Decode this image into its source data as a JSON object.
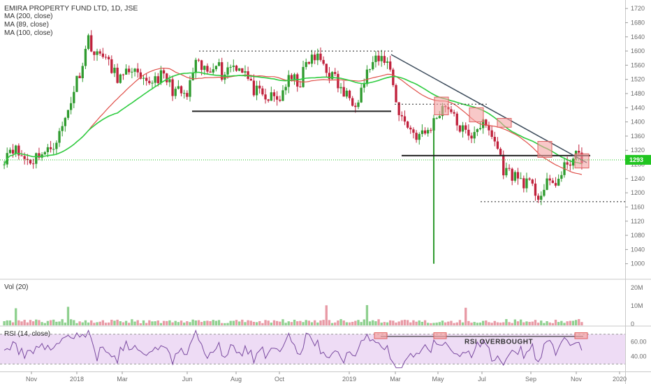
{
  "chart_title": "EMIRA PROPERTY FUND LTD, 1D, JSE",
  "indicators": [
    "MA (200, close)",
    "MA (89, close)",
    "MA (100, close)"
  ],
  "volume_label": "Vol (20)",
  "rsi_label": "RSI (14, close)",
  "annotation": "RSI OVERBOUGHT",
  "last_price": "1293",
  "colors": {
    "up": "#2f9b2f",
    "down": "#c0213c",
    "ma_green": "#2ecc40",
    "ma_red": "#e0504a",
    "rsi_line": "#7a4aa0",
    "rsi_band": "#eedcf5",
    "badge": "#21c521",
    "highlight_fill": "#f4a3a3",
    "highlight_stroke": "#e06060"
  },
  "chart_data": {
    "type": "candlestick",
    "title": "EMIRA PROPERTY FUND LTD, 1D, JSE",
    "x_ticks": [
      "Nov",
      "2018",
      "Mar",
      "Jun",
      "Aug",
      "Oct",
      "2019",
      "Mar",
      "May",
      "Jul",
      "Sep",
      "Nov",
      "2020"
    ],
    "price_ticks": [
      1000,
      1040,
      1080,
      1120,
      1160,
      1200,
      1240,
      1280,
      1320,
      1360,
      1400,
      1440,
      1480,
      1520,
      1560,
      1600,
      1640,
      1680,
      1720
    ],
    "price_range": [
      960,
      1740
    ],
    "volume_ticks": [
      "0",
      "10M",
      "20M"
    ],
    "rsi_ticks": [
      "40.00",
      "60.00"
    ],
    "rsi_range": [
      20,
      80
    ],
    "price_path": [
      1300,
      1335,
      1310,
      1295,
      1290,
      1315,
      1310,
      1340,
      1370,
      1430,
      1500,
      1560,
      1640,
      1580,
      1600,
      1550,
      1530,
      1520,
      1560,
      1520,
      1500,
      1520,
      1530,
      1520,
      1490,
      1480,
      1470,
      1560,
      1550,
      1540,
      1580,
      1530,
      1560,
      1560,
      1550,
      1500,
      1480,
      1460,
      1470,
      1460,
      1510,
      1520,
      1510,
      1570,
      1580,
      1575,
      1540,
      1520,
      1480,
      1470,
      1460,
      1510,
      1560,
      1570,
      1580,
      1540,
      1420,
      1400,
      1370,
      1360,
      1370,
      1400,
      1440,
      1450,
      1400,
      1380,
      1350,
      1390,
      1390,
      1370,
      1330,
      1260,
      1255,
      1240,
      1230,
      1210,
      1190,
      1220,
      1230,
      1240,
      1290,
      1300,
      1300
    ],
    "levels": [
      {
        "y": 1600,
        "style": "dotted"
      },
      {
        "y": 1430,
        "style": "solid"
      },
      {
        "y": 1450,
        "style": "dotted"
      },
      {
        "y": 1305,
        "style": "solid"
      },
      {
        "y": 1175,
        "style": "dotted"
      }
    ],
    "trendline": {
      "from": 1590,
      "to": 1285
    },
    "spike_low": 1000,
    "last_price": 1293
  }
}
